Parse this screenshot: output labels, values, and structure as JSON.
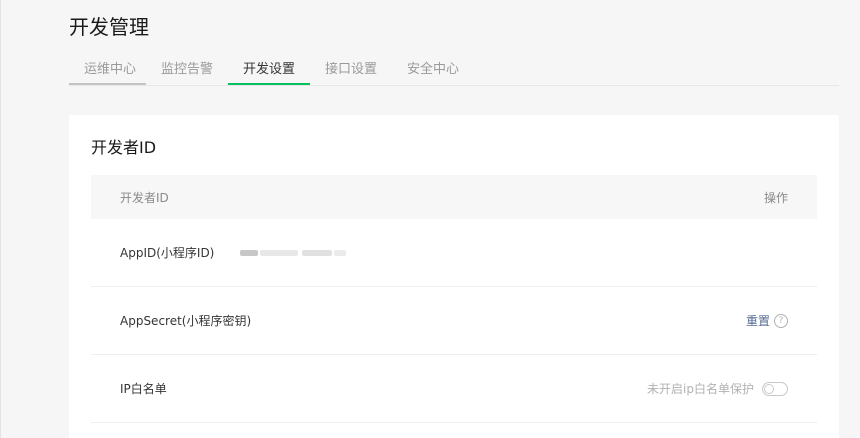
{
  "page": {
    "title": "开发管理"
  },
  "tabs": [
    {
      "label": "运维中心",
      "state": "underlined"
    },
    {
      "label": "监控告警",
      "state": "inactive"
    },
    {
      "label": "开发设置",
      "state": "active"
    },
    {
      "label": "接口设置",
      "state": "inactive"
    },
    {
      "label": "安全中心",
      "state": "inactive"
    }
  ],
  "developer_id": {
    "section_title": "开发者ID",
    "table_header": {
      "name": "开发者ID",
      "action": "操作"
    },
    "rows": {
      "appid": {
        "label": "AppID(小程序ID)",
        "value_masked": true
      },
      "appsecret": {
        "label": "AppSecret(小程序密钥)",
        "action_label": "重置",
        "help_glyph": "?"
      },
      "ip_whitelist": {
        "label": "IP白名单",
        "status_text": "未开启ip白名单保护",
        "toggle_on": false
      }
    }
  },
  "colors": {
    "accent": "#07c160",
    "link": "#576b95",
    "muted": "#9a9a9a"
  },
  "icons": {
    "help": "question-circle-icon",
    "toggle": "switch-toggle"
  }
}
